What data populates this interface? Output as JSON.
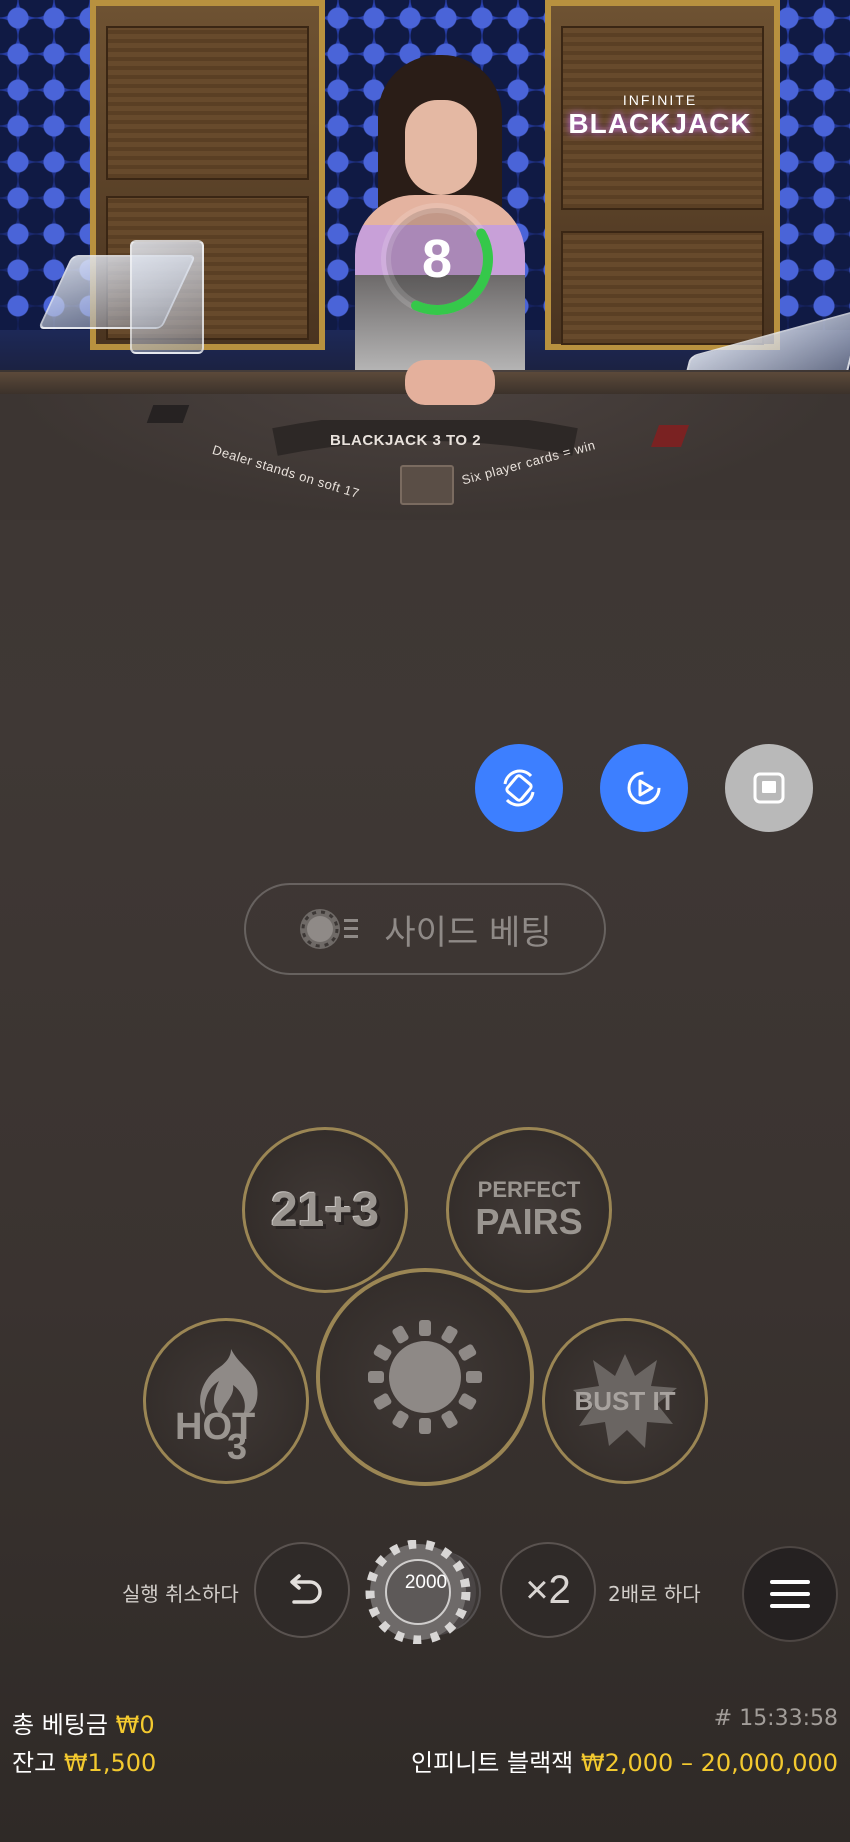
{
  "stream": {
    "logo_line1": "INFINITE",
    "logo_line2": "BLACKJACK",
    "timer_value": "8",
    "timer_fraction": 0.4,
    "felt_title": "BLACKJACK 3 TO 2",
    "felt_left": "Dealer stands on soft 17",
    "felt_right": "Six player cards = win"
  },
  "view_controls": {
    "icons": [
      "rotate-view-icon",
      "video-rotate-icon",
      "stop-square-icon"
    ]
  },
  "side_bet": {
    "label": "사이드 베팅",
    "icon": "chip-list-icon"
  },
  "bet_spots": {
    "twenty_one_three": "21+3",
    "perfect_pairs_top": "PERFECT",
    "perfect_pairs_bottom": "PAIRS",
    "hot3_top": "HOT",
    "hot3_digit": "3",
    "bust_it": "BUST IT"
  },
  "controls": {
    "undo_label": "실행 취소하다",
    "double_label": "2배로 하다",
    "double_symbol": "×2",
    "chip_value": "2000"
  },
  "footer": {
    "total_bet_label": "총 베팅금",
    "total_bet_value": "₩0",
    "balance_label": "잔고",
    "balance_value": "₩1,500",
    "round_time": "# 15:33:58",
    "game_name": "인피니트 블랙잭",
    "limits": "₩2,000 – 20,000,000"
  },
  "colors": {
    "accent_blue": "#3d7fff",
    "gold": "#f3c92f",
    "timer_green": "#35c84a"
  }
}
